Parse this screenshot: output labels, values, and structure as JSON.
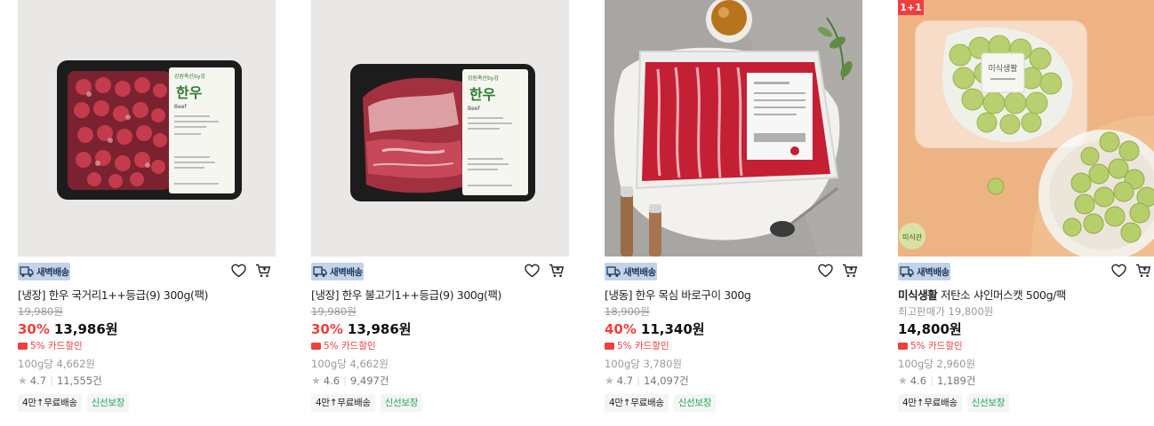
{
  "delivery_label": "새벽배송",
  "products": [
    {
      "name_prefix": "",
      "name": "[냉장] 한우 국거리1++등급(9) 300g(팩)",
      "original_price": "19,980원",
      "discount_rate": "30%",
      "price": "13,986원",
      "card_discount": "5% 카드할인",
      "unit_price": "100g당 4,662원",
      "rating": "4.7",
      "reviews": "11,555건",
      "tags": [
        "4만↑무료배송",
        "신선보장"
      ]
    },
    {
      "name_prefix": "",
      "name": "[냉장] 한우 불고기1++등급(9) 300g(팩)",
      "original_price": "19,980원",
      "discount_rate": "30%",
      "price": "13,986원",
      "card_discount": "5% 카드할인",
      "unit_price": "100g당 4,662원",
      "rating": "4.6",
      "reviews": "9,497건",
      "tags": [
        "4만↑무료배송",
        "신선보장"
      ]
    },
    {
      "name_prefix": "",
      "name": "[냉동] 한우 목심 바로구이 300g",
      "original_price": "18,900원",
      "discount_rate": "40%",
      "price": "11,340원",
      "card_discount": "5% 카드할인",
      "unit_price": "100g당 3,780원",
      "rating": "4.7",
      "reviews": "14,097건",
      "tags": [
        "4만↑무료배송",
        "신선보장"
      ]
    },
    {
      "name_prefix": "미식생활",
      "name": " 저탄소 샤인머스캣 500g/팩",
      "reference_price": "최고판매가 19,800원",
      "price": "14,800원",
      "card_discount": "5% 카드할인",
      "unit_price": "100g당 2,960원",
      "rating": "4.6",
      "reviews": "1,189건",
      "tags": [
        "4만↑무료배송",
        "신선보장"
      ],
      "image_badge": "1+1",
      "image_stamp": "미식관",
      "package_label": "미식생활"
    }
  ],
  "package_text": {
    "brand": "한우",
    "sub": "Beef"
  },
  "colors": {
    "discount": "#f03e3e",
    "green": "#1ea94c",
    "delivery_bg": "#c4d3e5"
  }
}
